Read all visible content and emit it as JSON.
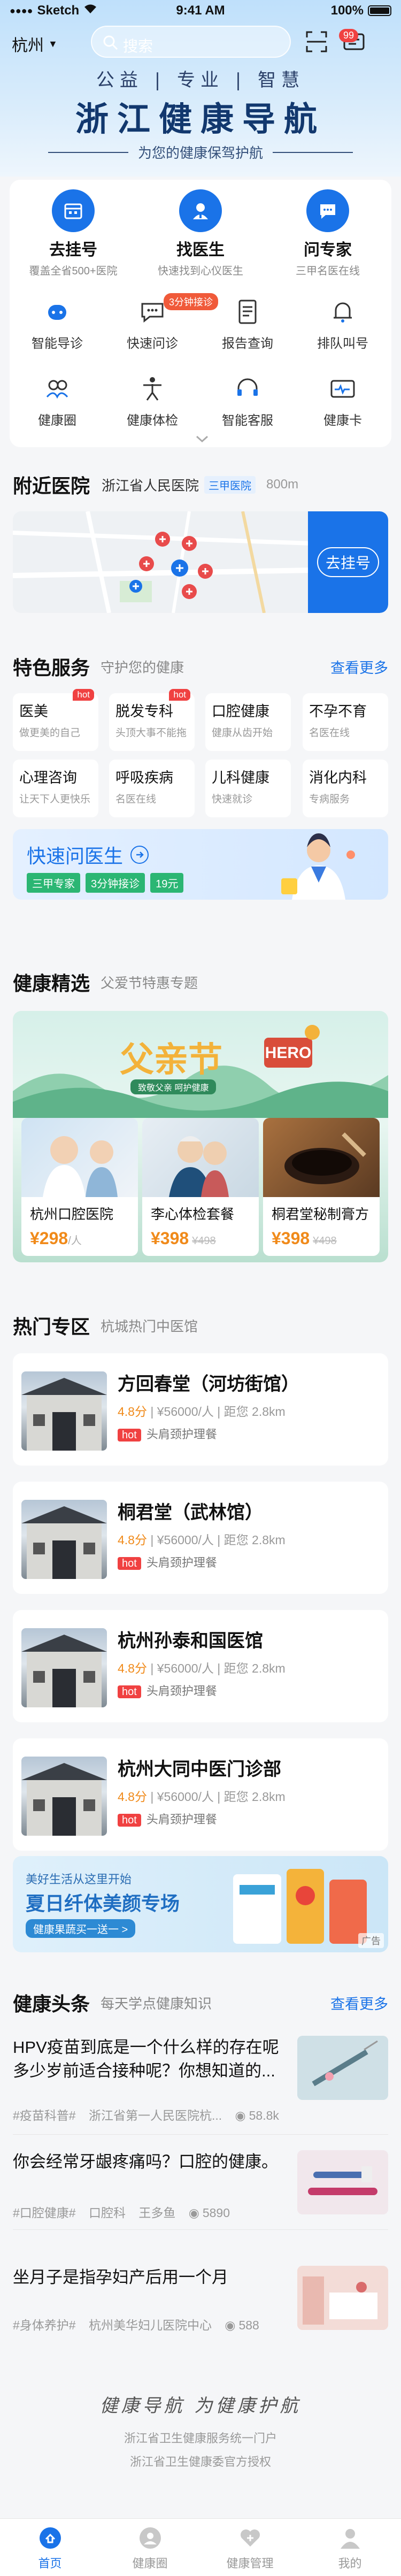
{
  "status": {
    "carrier": "Sketch",
    "time": "9:41 AM",
    "battery": "100%"
  },
  "topbar": {
    "city": "杭州",
    "search_placeholder": "搜索",
    "badge": "99"
  },
  "hero": {
    "slogan": "公益 | 专业 | 智慧",
    "title": "浙江健康导航",
    "subtitle": "为您的健康保驾护航"
  },
  "services": {
    "primary": [
      {
        "title": "去挂号",
        "sub": "覆盖全省500+医院",
        "icon": "calendar-icon"
      },
      {
        "title": "找医生",
        "sub": "快速找到心仪医生",
        "icon": "doctor-icon"
      },
      {
        "title": "问专家",
        "sub": "三甲名医在线",
        "icon": "chat-icon"
      }
    ],
    "grid": [
      {
        "label": "智能导诊",
        "icon": "robot-icon"
      },
      {
        "label": "快速问诊",
        "icon": "message-icon"
      },
      {
        "label": "报告查询",
        "icon": "report-icon"
      },
      {
        "label": "排队叫号",
        "icon": "bell-icon"
      },
      {
        "label": "健康圈",
        "icon": "community-icon"
      },
      {
        "label": "健康体检",
        "icon": "body-icon"
      },
      {
        "label": "智能客服",
        "icon": "headset-icon"
      },
      {
        "label": "健康卡",
        "icon": "card-icon"
      }
    ],
    "wait_tag": "3分钟接诊"
  },
  "nearby": {
    "title": "附近医院",
    "hospital": "浙江省人民医院",
    "level": "三甲医院",
    "distance": "800m",
    "button": "去挂号"
  },
  "special": {
    "title": "特色服务",
    "sub": "守护您的健康",
    "more": "查看更多",
    "items": [
      {
        "title": "医美",
        "sub": "做更美的自己",
        "hot": "hot"
      },
      {
        "title": "脱发专科",
        "sub": "头顶大事不能拖",
        "hot": "hot"
      },
      {
        "title": "口腔健康",
        "sub": "健康从齿开始",
        "hot": ""
      },
      {
        "title": "不孕不育",
        "sub": "名医在线",
        "hot": ""
      },
      {
        "title": "心理咨询",
        "sub": "让天下人更快乐",
        "hot": ""
      },
      {
        "title": "呼吸疾病",
        "sub": "名医在线",
        "hot": ""
      },
      {
        "title": "儿科健康",
        "sub": "快速就诊",
        "hot": ""
      },
      {
        "title": "消化内科",
        "sub": "专病服务",
        "hot": ""
      }
    ],
    "quick": {
      "title": "快速问医生",
      "tags": [
        "三甲专家",
        "3分钟接诊",
        "19元"
      ]
    }
  },
  "health": {
    "title": "健康精选",
    "sub": "父爱节特惠专题",
    "banner_title": "父亲节",
    "banner_sub": "致敬父亲 呵护健康",
    "products": [
      {
        "name": "杭州口腔医院",
        "price": "¥298",
        "unit": "/人",
        "old": ""
      },
      {
        "name": "李心体检套餐",
        "price": "¥398",
        "unit": "",
        "old": "¥498"
      },
      {
        "name": "桐君堂秘制膏方",
        "price": "¥398",
        "unit": "",
        "old": "¥498"
      }
    ]
  },
  "hot_zone": {
    "title": "热门专区",
    "sub": "杭城热门中医馆",
    "items": [
      {
        "name": "方回春堂（河坊街馆）",
        "rating": "4.8分",
        "price": "¥56000/人",
        "distance": "距您 2.8km",
        "tag": "hot",
        "service": "头肩颈护理餐"
      },
      {
        "name": "桐君堂（武林馆）",
        "rating": "4.8分",
        "price": "¥56000/人",
        "distance": "距您 2.8km",
        "tag": "hot",
        "service": "头肩颈护理餐"
      },
      {
        "name": "杭州孙泰和国医馆",
        "rating": "4.8分",
        "price": "¥56000/人",
        "distance": "距您 2.8km",
        "tag": "hot",
        "service": "头肩颈护理餐"
      },
      {
        "name": "杭州大同中医门诊部",
        "rating": "4.8分",
        "price": "¥56000/人",
        "distance": "距您 2.8km",
        "tag": "hot",
        "service": "头肩颈护理餐"
      }
    ]
  },
  "ad": {
    "line1": "美好生活从这里开始",
    "line2": "夏日纤体美颜专场",
    "line3": "健康果蔬买一送一 >",
    "tag": "广告"
  },
  "news": {
    "title": "健康头条",
    "sub": "每天学点健康知识",
    "more": "查看更多",
    "items": [
      {
        "title": "HPV疫苗到底是一个什么样的存在呢多少岁前适合接种呢？你想知道的...",
        "tag": "#疫苗科普#",
        "source": "浙江省第一人民医院杭...",
        "views": "58.8k"
      },
      {
        "title": "你会经常牙龈疼痛吗？口腔的健康。",
        "tag": "#口腔健康#",
        "source": "口腔科",
        "author": "王多鱼",
        "views": "5890"
      },
      {
        "title": "坐月子是指孕妇产后用一个月",
        "tag": "#身体养护#",
        "source": "杭州美华妇儿医院中心",
        "views": "588"
      }
    ]
  },
  "footer": {
    "slogan": "健康导航 为健康护航",
    "line1": "浙江省卫生健康服务统一门户",
    "line2": "浙江省卫生健康委官方授权"
  },
  "tabs": [
    "首页",
    "健康圈",
    "健康管理",
    "我的"
  ],
  "colors": {
    "primary": "#1a73e8",
    "hot": "#f04141",
    "price": "#f08a1a",
    "green": "#2bb673"
  }
}
